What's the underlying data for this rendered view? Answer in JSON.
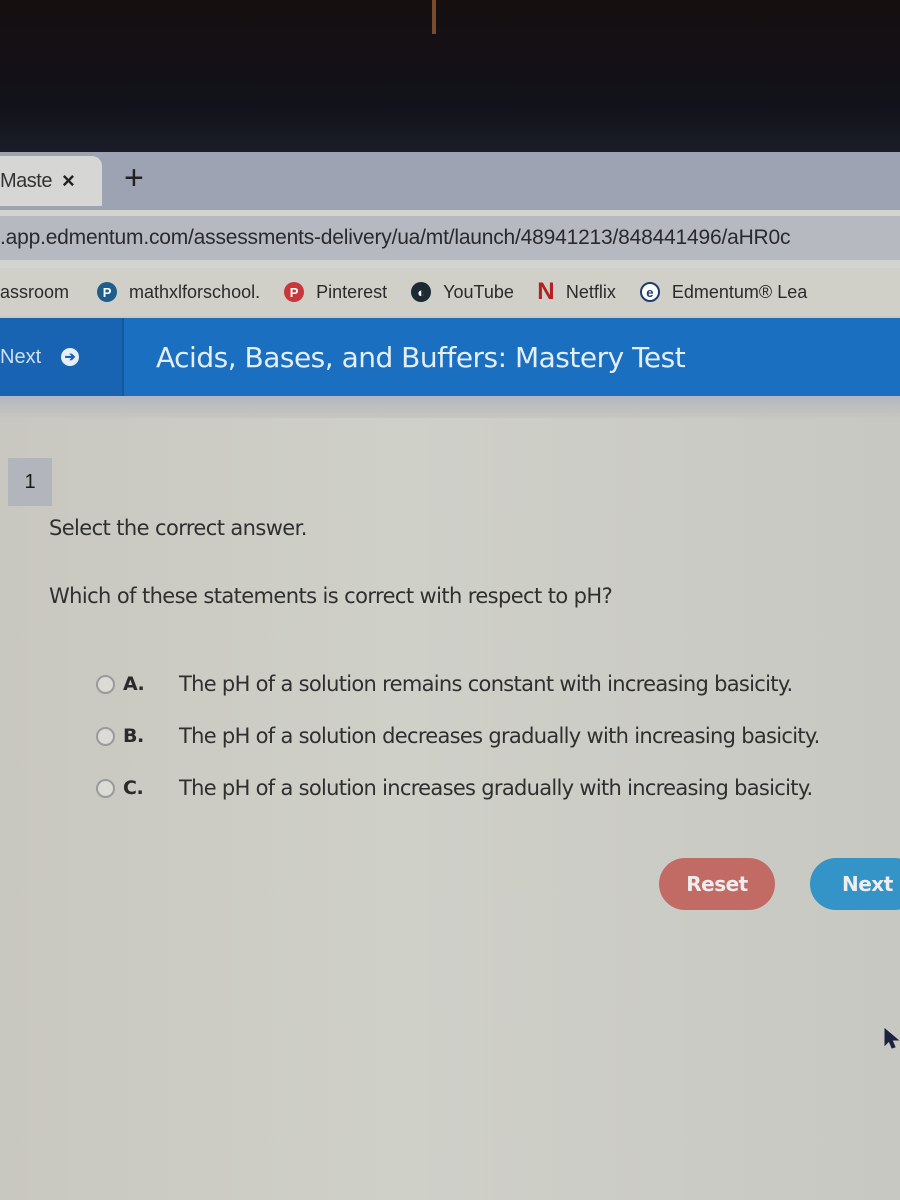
{
  "browser": {
    "tab": {
      "title": "Maste",
      "close_icon": "×"
    },
    "new_tab_icon": "+",
    "url": ".app.edmentum.com/assessments-delivery/ua/mt/launch/48941213/848441496/aHR0c",
    "bookmarks": [
      {
        "label": "assroom",
        "icon": ""
      },
      {
        "label": "mathxlforschool.",
        "icon": "P"
      },
      {
        "label": "Pinterest",
        "icon": "P"
      },
      {
        "label": "YouTube",
        "icon": "◐"
      },
      {
        "label": "Netflix",
        "icon": "N"
      },
      {
        "label": "Edmentum® Lea",
        "icon": "e"
      }
    ]
  },
  "app": {
    "next_label": "Next",
    "next_icon": "➔",
    "test_title": "Acids, Bases, and Buffers: Mastery Test",
    "brand_color": "#1a6fc0"
  },
  "question": {
    "number": "1",
    "instruction": "Select the correct answer.",
    "prompt": "Which of these statements is correct with respect to pH?",
    "options": [
      {
        "letter": "A.",
        "text": "The pH of a solution remains constant with increasing basicity."
      },
      {
        "letter": "B.",
        "text": "The pH of a solution decreases gradually with increasing basicity."
      },
      {
        "letter": "C.",
        "text": "The pH of a solution increases gradually with increasing basicity."
      }
    ]
  },
  "actions": {
    "reset_label": "Reset",
    "next_label": "Next",
    "reset_color": "#c26a64",
    "next_color": "#3493c7"
  }
}
